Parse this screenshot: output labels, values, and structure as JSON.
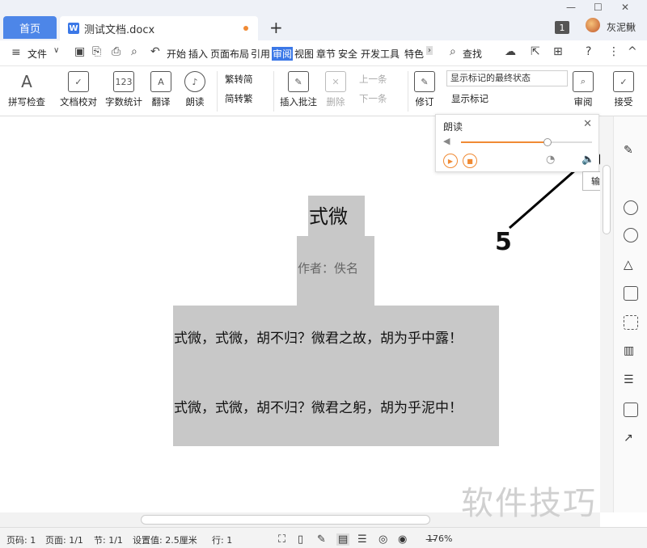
{
  "tabs": {
    "home": "首页",
    "doc": "测试文档.docx",
    "new_tab": "+"
  },
  "window": {
    "badge": "1",
    "user": "灰泥鳅"
  },
  "menu": {
    "file": "文件",
    "items": [
      "开始",
      "插入",
      "页面布局",
      "引用",
      "审阅",
      "视图",
      "章节",
      "安全",
      "开发工具",
      "特色"
    ],
    "active": "审阅",
    "search": "查找"
  },
  "ribbon": {
    "spellcheck": "拼写检查",
    "proofread": "文档校对",
    "wordcount": "字数统计",
    "translate": "翻译",
    "read_aloud": "朗读",
    "trad_simp": "繁转简",
    "simp_trad": "简转繁",
    "insert_comment": "插入批注",
    "delete": "删除",
    "prev": "上一条",
    "next": "下一条",
    "revise": "修订",
    "display_mode": "显示标记的最终状态",
    "show_markup": "显示标记",
    "review": "审阅",
    "accept": "接受"
  },
  "read_panel": {
    "title": "朗读",
    "tooltip": "输出语音",
    "volume_fraction": 0.66
  },
  "annotation": {
    "number": "5"
  },
  "document": {
    "title": "式微",
    "author": "作者：佚名",
    "line1": "式微，式微，胡不归？微君之故，胡为乎中露！",
    "line2": "式微，式微，胡不归？微君之躬，胡为乎泥中！"
  },
  "status": {
    "page": "页码: 1",
    "pages": "页面: 1/1",
    "section": "节: 1/1",
    "setting": "设置值: 2.5厘米",
    "row": "行: 1",
    "zoom": "176%"
  },
  "watermark": "软件技巧",
  "colors": {
    "accent": "#3b78e7",
    "highlight": "#c8c8c8",
    "orange": "#f08a34"
  }
}
